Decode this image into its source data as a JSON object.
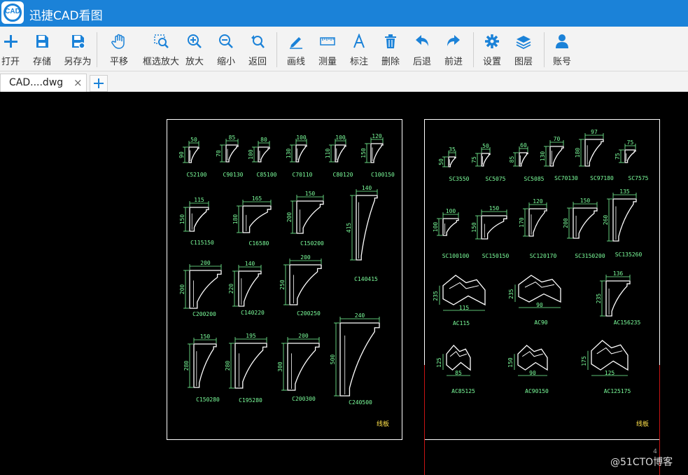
{
  "app": {
    "title": "迅捷CAD看图",
    "logo_text": "CAD"
  },
  "toolbar": {
    "items": [
      {
        "label": "打开",
        "icon": "plus-icon"
      },
      {
        "label": "存储",
        "icon": "save-icon"
      },
      {
        "label": "另存为",
        "icon": "save-as-icon"
      },
      {
        "label": "平移",
        "icon": "hand-icon"
      },
      {
        "label": "框选放大",
        "icon": "zoom-window-icon"
      },
      {
        "label": "放大",
        "icon": "zoom-in-icon"
      },
      {
        "label": "缩小",
        "icon": "zoom-out-icon"
      },
      {
        "label": "返回",
        "icon": "zoom-back-icon"
      },
      {
        "label": "画线",
        "icon": "pencil-icon"
      },
      {
        "label": "测量",
        "icon": "ruler-icon"
      },
      {
        "label": "标注",
        "icon": "text-annotation-icon"
      },
      {
        "label": "删除",
        "icon": "trash-icon"
      },
      {
        "label": "后退",
        "icon": "undo-icon"
      },
      {
        "label": "前进",
        "icon": "redo-icon"
      },
      {
        "label": "设置",
        "icon": "gear-icon"
      },
      {
        "label": "图层",
        "icon": "layers-icon"
      },
      {
        "label": "账号",
        "icon": "user-icon"
      }
    ]
  },
  "tabs": [
    {
      "label": "CAD....dwg",
      "close": "×"
    }
  ],
  "drawing": {
    "left_sheet": {
      "title": "线板",
      "parts": [
        "C52100",
        "C90130",
        "C85100",
        "C70110",
        "C80120",
        "C100150",
        "C115150",
        "C16580",
        "C150200",
        "C140415",
        "C200200",
        "C140220",
        "C200250",
        "C150280",
        "C195280",
        "C200300",
        "C240500"
      ],
      "dims": [
        "50",
        "90",
        "85",
        "70",
        "80",
        "100",
        "100",
        "130",
        "100",
        "110",
        "120",
        "150",
        "115",
        "150",
        "165",
        "180",
        "150",
        "200",
        "140",
        "415",
        "200",
        "200",
        "140",
        "220",
        "200",
        "250",
        "150",
        "280",
        "195",
        "280",
        "200",
        "300",
        "240",
        "500"
      ]
    },
    "right_sheet": {
      "title": "线板",
      "page_number": "4",
      "parts": [
        "SC3550",
        "SC5075",
        "SC5085",
        "SC70130",
        "SC97180",
        "SC7575",
        "SC100100",
        "SC150150",
        "SC120170",
        "SC3150200",
        "SC135260",
        "AC115",
        "AC90",
        "AC156235",
        "AC85125",
        "AC90150",
        "AC125175"
      ],
      "dims": [
        "35",
        "50",
        "50",
        "75",
        "60",
        "85",
        "70",
        "130",
        "97",
        "180",
        "75",
        "75",
        "100",
        "100",
        "150",
        "150",
        "120",
        "170",
        "150",
        "200",
        "135",
        "260",
        "115",
        "235",
        "90",
        "235",
        "136",
        "235",
        "85",
        "125",
        "90",
        "150",
        "125",
        "175"
      ]
    }
  },
  "watermark": "@51CTO博客",
  "colors": {
    "titlebar": "#1b82d8",
    "icon_blue": "#1b82d8",
    "cad_white": "#ffffff",
    "cad_green": "#7cff9c",
    "cad_yellow": "#ffe14a",
    "cad_red": "#c81414"
  }
}
